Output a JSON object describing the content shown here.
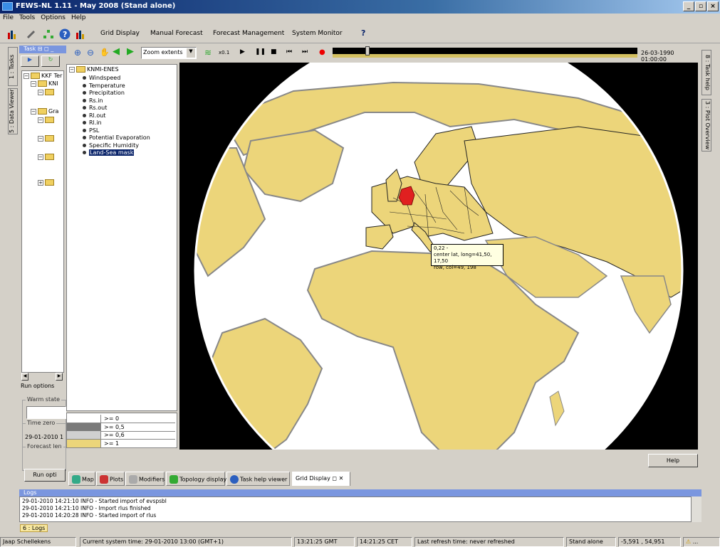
{
  "window": {
    "title": "FEWS-NL 1.11 - May 2008  (Stand alone)"
  },
  "menu": [
    "File",
    "Tools",
    "Options",
    "Help"
  ],
  "toolbar": {
    "buttons": [
      "Grid Display",
      "Manual Forecast",
      "Forecast Management",
      "System Monitor"
    ],
    "help_glyph": "?"
  },
  "left_tabs": [
    "1 : Tasks",
    "5 : Data Viewer"
  ],
  "right_tabs": [
    "8 : Task help",
    "3 : Plot Overview"
  ],
  "tasks": {
    "header": "Task",
    "tree": [
      "KKF Ter",
      "KNI",
      "Gra"
    ],
    "run_options_label": "Run options",
    "warm_state_label": "Warm state",
    "time_zero_label": "Time zero",
    "time_zero_value": "29-01-2010 1",
    "forecast_length_label": "Forecast len",
    "run_button": "Run opti"
  },
  "grid": {
    "zoom_select": "Zoom extents",
    "speed": "x0.1",
    "timestamp": "26-03-1990 01:00:00",
    "tree_root": "KNMI-ENES",
    "parameters": [
      "Windspeed",
      "Temperature",
      "Precipitation",
      "Rs.in",
      "Rs.out",
      "Rl.out",
      "Rl.in",
      "PSL",
      "Potential Evaporation",
      "Specific Humidity",
      "Land-Sea mask"
    ],
    "selected_parameter": "Land-Sea mask",
    "legend": [
      {
        "label": ">= 0",
        "color": "#ffffff"
      },
      {
        "label": ">= 0,5",
        "color": "#7a7a7a"
      },
      {
        "label": ">= 0,6",
        "color": "#d0d0d0"
      },
      {
        "label": ">= 1",
        "color": "#ecd57a"
      }
    ],
    "tooltip": {
      "line1": "0,22 -",
      "line2": "center lat, long=41,50, 17,50",
      "line3": "row, col=49, 198"
    },
    "help_button": "Help"
  },
  "bottom_tabs": [
    "Map",
    "Plots",
    "Modifiers",
    "Topology display",
    "Task help viewer",
    "Grid Display"
  ],
  "logs": {
    "title": "Logs",
    "lines": [
      "29-01-2010 14:21:10 INFO - Started import of evspsbl",
      "29-01-2010 14:21:10 INFO - Import rlus finished",
      "29-01-2010 14:20:28 INFO - Started import of rlus"
    ],
    "tab": "6 : Logs"
  },
  "status": {
    "user": "Jaap Schellekens",
    "system_time": "Current system time: 29-01-2010 13:00 (GMT+1)",
    "gmt": "13:21:25 GMT",
    "cet": "14:21:25 CET",
    "refresh": "Last refresh time: never refreshed",
    "mode": "Stand alone",
    "coords": "-5,591 , 54,951",
    "warn": "..."
  },
  "colors": {
    "land": "#ecd57a",
    "sea": "#ffffff",
    "highlight": "#e02020",
    "title_bar": "#0a246a",
    "tooltip_bg": "#ffffe1"
  }
}
